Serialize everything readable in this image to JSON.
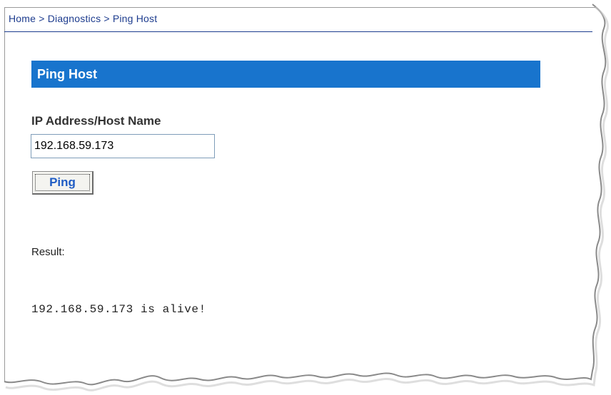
{
  "breadcrumb": {
    "text": "Home > Diagnostics > Ping Host"
  },
  "section": {
    "title": "Ping Host"
  },
  "form": {
    "field_label": "IP Address/Host Name",
    "ip_value": "192.168.59.173",
    "ping_button_label": "Ping"
  },
  "result": {
    "label": "Result:",
    "output": "192.168.59.173 is alive!"
  },
  "colors": {
    "header_bar": "#1874cd",
    "breadcrumb_text": "#1d3c8e",
    "button_text": "#1f5cc4"
  }
}
